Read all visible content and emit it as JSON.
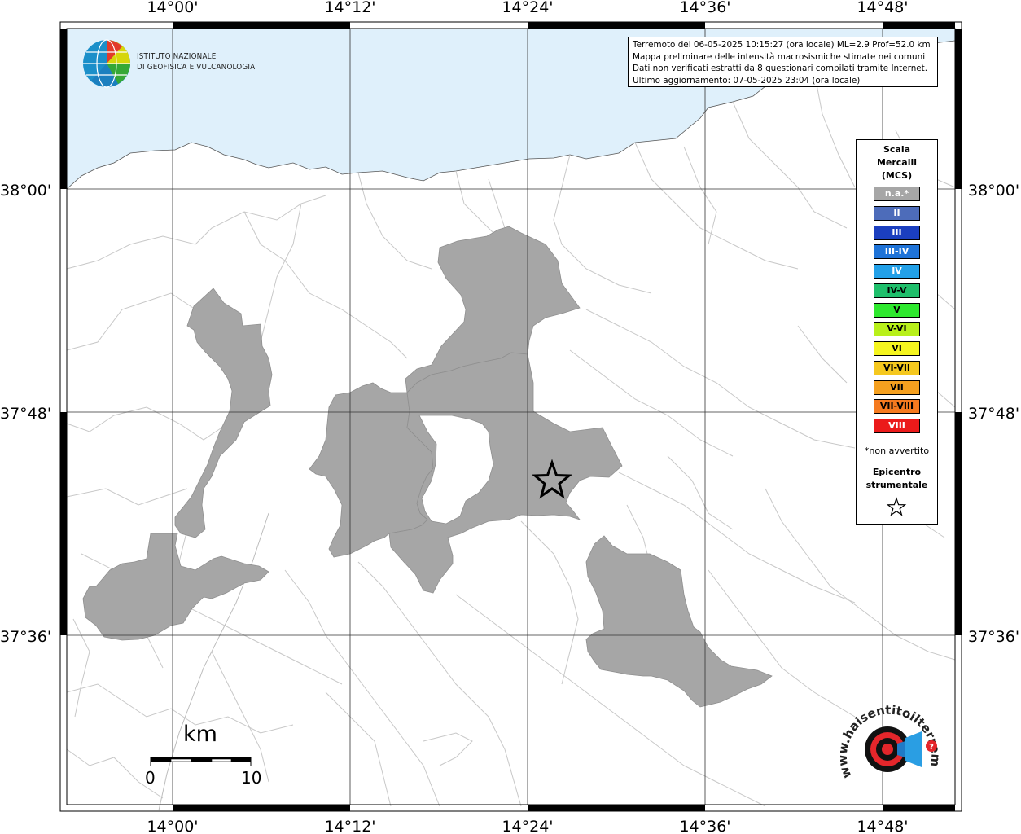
{
  "header": {
    "lines": [
      "Terremoto del 06-05-2025 10:15:27 (ora locale) ML=2.9 Prof=52.0 km",
      "Mappa preliminare delle intensità macrosismiche stimate nei comuni",
      "Dati non verificati estratti da 8 questionari compilati tramite Internet.",
      "Ultimo aggiornamento: 07-05-2025 23:04 (ora locale)"
    ]
  },
  "institute": {
    "line1": "ISTITUTO NAZIONALE",
    "line2": "DI GEOFISICA E VULCANOLOGIA"
  },
  "axes": {
    "longitudes": [
      "14°00'",
      "14°12'",
      "14°24'",
      "14°36'",
      "14°48'"
    ],
    "latitudes": [
      "38°00'",
      "37°48'",
      "37°36'"
    ]
  },
  "legend": {
    "title": [
      "Scala",
      "Mercalli",
      "(MCS)"
    ],
    "items": [
      {
        "label": "n.a.*",
        "color": "#a6a6a6",
        "text_color": "#ffffff"
      },
      {
        "label": "II",
        "color": "#4d6cba",
        "text_color": "#ffffff"
      },
      {
        "label": "III",
        "color": "#1b3fbf",
        "text_color": "#ffffff"
      },
      {
        "label": "III-IV",
        "color": "#1e73d8",
        "text_color": "#ffffff"
      },
      {
        "label": "IV",
        "color": "#22a0e8",
        "text_color": "#ffffff"
      },
      {
        "label": "IV-V",
        "color": "#1fbf6b",
        "text_color": "#000000"
      },
      {
        "label": "V",
        "color": "#2ee82e",
        "text_color": "#000000"
      },
      {
        "label": "V-VI",
        "color": "#b8f01a",
        "text_color": "#000000"
      },
      {
        "label": "VI",
        "color": "#f5f51f",
        "text_color": "#000000"
      },
      {
        "label": "VI-VII",
        "color": "#f5c81f",
        "text_color": "#000000"
      },
      {
        "label": "VII",
        "color": "#f5a01f",
        "text_color": "#000000"
      },
      {
        "label": "VII-VIII",
        "color": "#f57a1f",
        "text_color": "#000000"
      },
      {
        "label": "VIII",
        "color": "#eb1a1a",
        "text_color": "#ffffff"
      }
    ],
    "note": "*non avvertito",
    "epicenter_label": [
      "Epicentro",
      "strumentale"
    ]
  },
  "scale_bar": {
    "unit": "km",
    "min": "0",
    "max": "10"
  },
  "watermark": {
    "text": "www.haisentitoilterremoto.it"
  },
  "colors": {
    "sea": "#dff0fb",
    "land": "#ffffff",
    "felt_area": "#a6a6a6",
    "borders": "#c8c8c8"
  }
}
